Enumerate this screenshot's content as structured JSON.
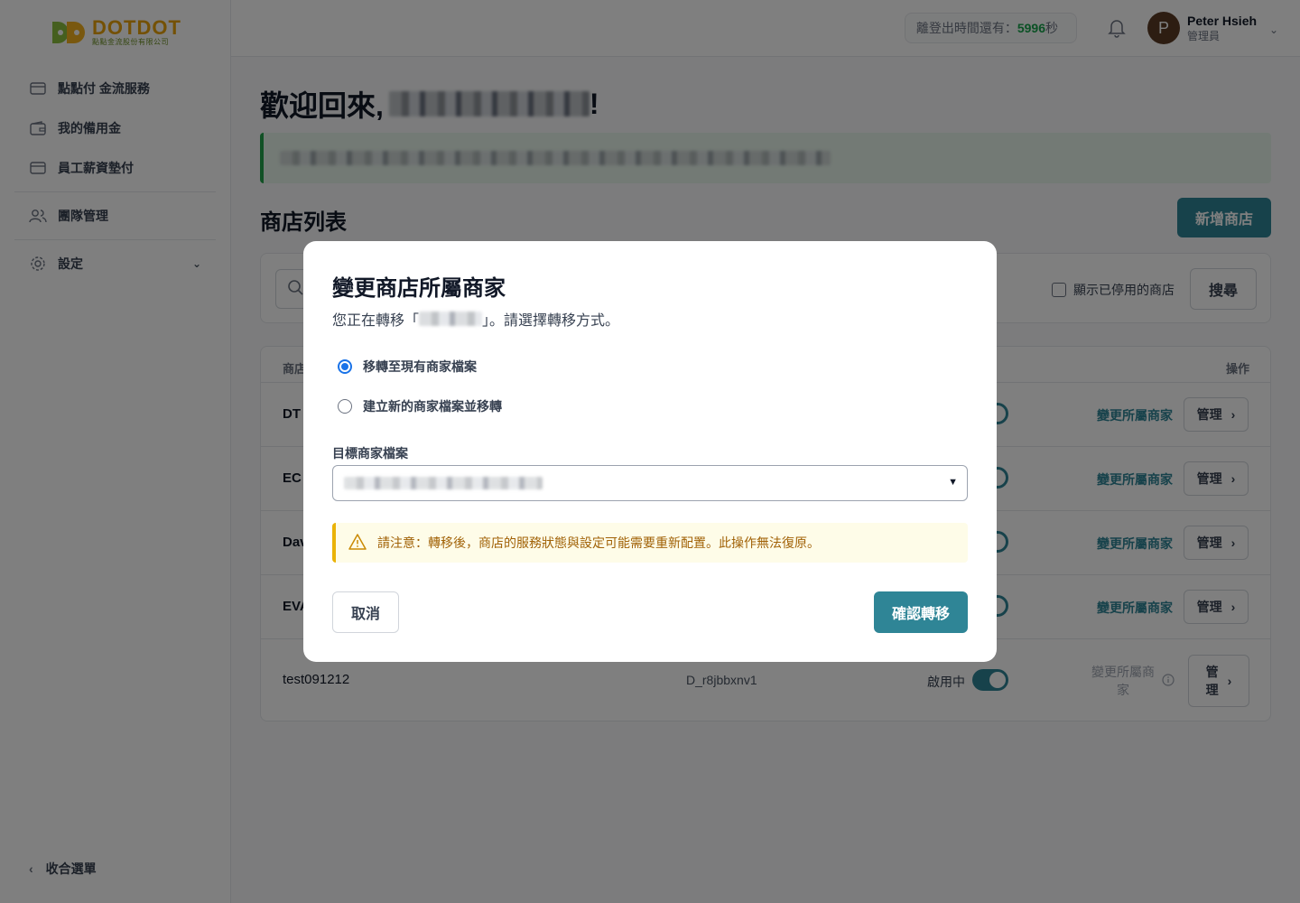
{
  "brand": {
    "name": "DOTDOT",
    "subtitle": "點點金流股份有限公司"
  },
  "sidebar": {
    "items": [
      {
        "label": "點點付 金流服務",
        "icon": "card-icon"
      },
      {
        "label": "我的備用金",
        "icon": "wallet-icon"
      },
      {
        "label": "員工薪資墊付",
        "icon": "card-icon"
      },
      {
        "label": "團隊管理",
        "icon": "users-icon"
      },
      {
        "label": "設定",
        "icon": "gear-icon"
      }
    ],
    "collapse_label": "收合選單"
  },
  "topbar": {
    "timer_label": "離登出時間還有：",
    "timer_value": "5996",
    "timer_unit": "秒",
    "avatar_initial": "P",
    "user_name": "Peter Hsieh",
    "user_role": "管理員"
  },
  "main": {
    "welcome_prefix": "歡迎回來,",
    "welcome_suffix": "!",
    "section_title": "商店列表",
    "add_store_label": "新增商店",
    "show_disabled_label": "顯示已停用的商店",
    "search_button_label": "搜尋",
    "table": {
      "header_store": "商店",
      "header_actions": "操作",
      "rows": [
        {
          "name": "DT",
          "change_label": "變更所屬商家",
          "manage_label": "管理"
        },
        {
          "name": "EC",
          "change_label": "變更所屬商家",
          "manage_label": "管理"
        },
        {
          "name": "Dav",
          "change_label": "變更所屬商家",
          "manage_label": "管理"
        },
        {
          "name": "EVA",
          "change_label": "變更所屬商家",
          "manage_label": "管理"
        },
        {
          "name": "test091212",
          "code": "D_r8jbbxnv1",
          "status": "啟用中",
          "change_label": "變更所屬商家",
          "manage_label": "管理"
        }
      ]
    }
  },
  "modal": {
    "title": "變更商店所屬商家",
    "desc_prefix": "您正在轉移「",
    "desc_suffix": "」。請選擇轉移方式。",
    "options": [
      {
        "label": "移轉至現有商家檔案",
        "selected": true
      },
      {
        "label": "建立新的商家檔案並移轉",
        "selected": false
      }
    ],
    "target_label": "目標商家檔案",
    "warning": "請注意：轉移後，商店的服務狀態與設定可能需要重新配置。此操作無法復原。",
    "cancel_label": "取消",
    "confirm_label": "確認轉移"
  },
  "colors": {
    "primary": "#2f8596",
    "success": "#16a34a",
    "warning": "#a16207",
    "radio": "#1a73e8"
  }
}
